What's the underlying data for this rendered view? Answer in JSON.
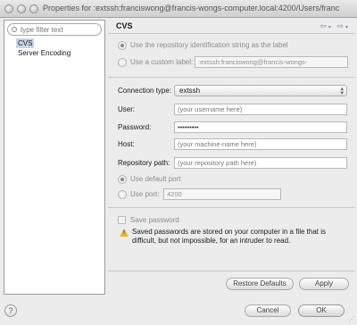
{
  "window": {
    "title": "Properties for :extssh:franciswong@francis-wongs-computer.local:4200/Users/franc"
  },
  "sidebar": {
    "filter_placeholder": "type filter text",
    "items": [
      {
        "label": "CVS",
        "selected": true
      },
      {
        "label": "Server Encoding",
        "selected": false
      }
    ]
  },
  "page": {
    "title": "CVS",
    "nav_icons": [
      "back-arrow-icon",
      "dropdown-icon",
      "forward-arrow-icon",
      "dropdown-icon"
    ]
  },
  "label_options": {
    "use_repo_id": "Use the repository identification string as the label",
    "use_custom": "Use a custom label:",
    "custom_label_value": ":extssh:franciswong@francis-wongs-"
  },
  "connection": {
    "type_label": "Connection type:",
    "type_value": "extssh",
    "user_label": "User:",
    "user_placeholder": "(your username here)",
    "password_label": "Password:",
    "password_value": "•••••••••",
    "host_label": "Host:",
    "host_placeholder": "(your machine-name here)",
    "repo_path_label": "Repository path:",
    "repo_path_placeholder": "(your repository path here)"
  },
  "port": {
    "default_label": "Use default port",
    "custom_label": "Use port:",
    "value": "4200"
  },
  "save_password": {
    "label": "Save password",
    "warning": "Saved passwords are stored on your computer in a file that is difficult, but not impossible, for an intruder to read."
  },
  "buttons": {
    "restore_defaults": "Restore Defaults",
    "apply": "Apply",
    "cancel": "Cancel",
    "ok": "OK",
    "help": "?"
  }
}
